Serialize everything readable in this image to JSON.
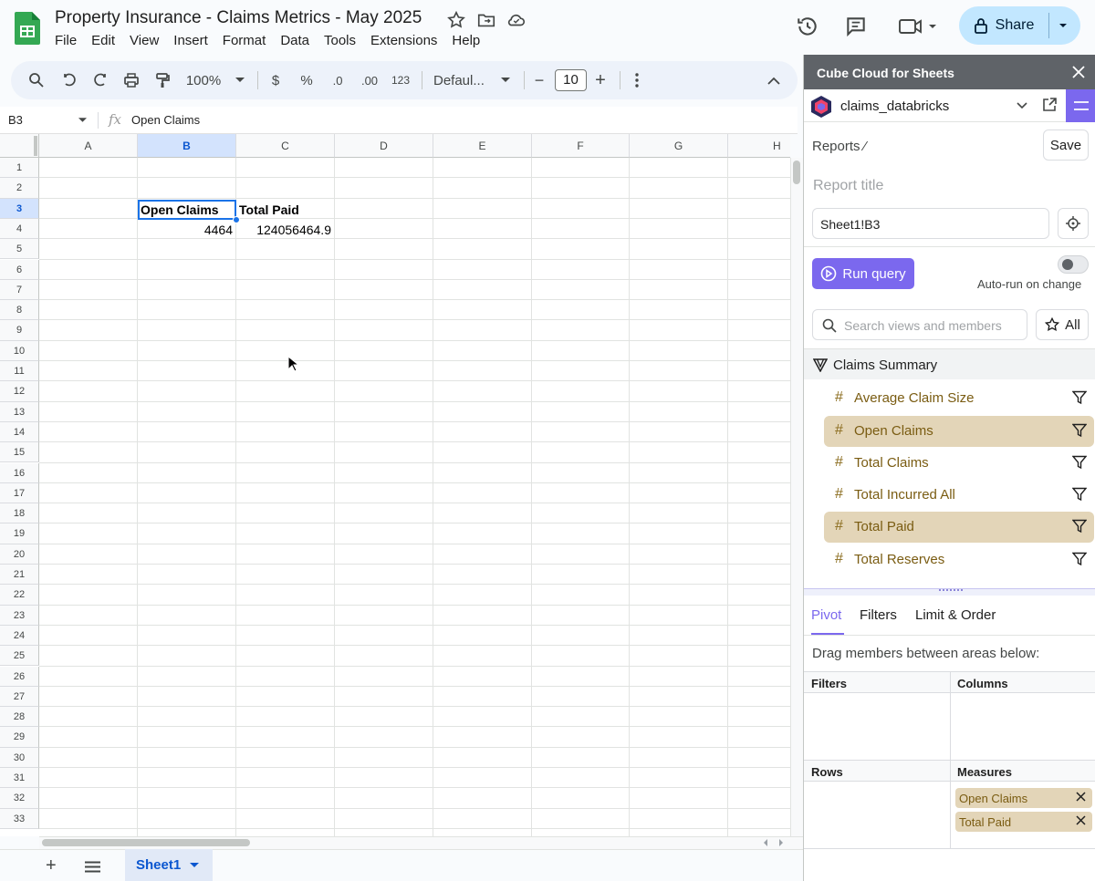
{
  "doc": {
    "title": "Property Insurance - Claims Metrics - May 2025",
    "menu": [
      "File",
      "Edit",
      "View",
      "Insert",
      "Format",
      "Data",
      "Tools",
      "Extensions",
      "Help"
    ],
    "share_label": "Share"
  },
  "toolbar": {
    "zoom": "100%",
    "currency": "$",
    "percent": "%",
    "dec_decrease": ".0",
    "dec_increase": ".00",
    "number_format": "123",
    "font": "Defaul...",
    "font_size": "10",
    "minus": "−",
    "plus": "+"
  },
  "formula_bar": {
    "cell_ref": "B3",
    "fx": "fx",
    "content": "Open Claims"
  },
  "grid": {
    "columns": [
      "A",
      "B",
      "C",
      "D",
      "E",
      "F",
      "G",
      "H"
    ],
    "rows": [
      "1",
      "2",
      "3",
      "4",
      "5",
      "6",
      "7",
      "8",
      "9",
      "10",
      "11",
      "12",
      "13",
      "14",
      "15",
      "16",
      "17",
      "18",
      "19",
      "20",
      "21",
      "22",
      "23",
      "24",
      "25",
      "26",
      "27",
      "28",
      "29",
      "30",
      "31",
      "32",
      "33"
    ],
    "cells": {
      "B3": "Open Claims",
      "C3": "Total Paid",
      "B4": "4464",
      "C4": "124056464.9"
    },
    "selected_cell": "B3"
  },
  "sheets": {
    "add": "+",
    "active": "Sheet1"
  },
  "panel": {
    "title": "Cube Cloud for Sheets",
    "connection": "claims_databricks",
    "reports_label": "Reports ⁄",
    "save_label": "Save",
    "report_title_placeholder": "Report title",
    "range": "Sheet1!B3",
    "run_label": "Run query",
    "autorun_label": "Auto-run on change",
    "search_placeholder": "Search views and members",
    "all_label": "All",
    "view_name": "Claims Summary",
    "members": [
      {
        "name": "Average Claim Size",
        "selected": false
      },
      {
        "name": "Open Claims",
        "selected": true
      },
      {
        "name": "Total Claims",
        "selected": false
      },
      {
        "name": "Total Incurred All",
        "selected": false
      },
      {
        "name": "Total Paid",
        "selected": true
      },
      {
        "name": "Total Reserves",
        "selected": false
      }
    ],
    "tabs": [
      "Pivot",
      "Filters",
      "Limit & Order"
    ],
    "drag_hint": "Drag members between areas below:",
    "zones": {
      "filters": "Filters",
      "columns": "Columns",
      "rows": "Rows",
      "measures": "Measures"
    },
    "measures": [
      "Open Claims",
      "Total Paid"
    ],
    "accent_color": "#7b68ee",
    "selected_color": "#e3d5b8"
  }
}
